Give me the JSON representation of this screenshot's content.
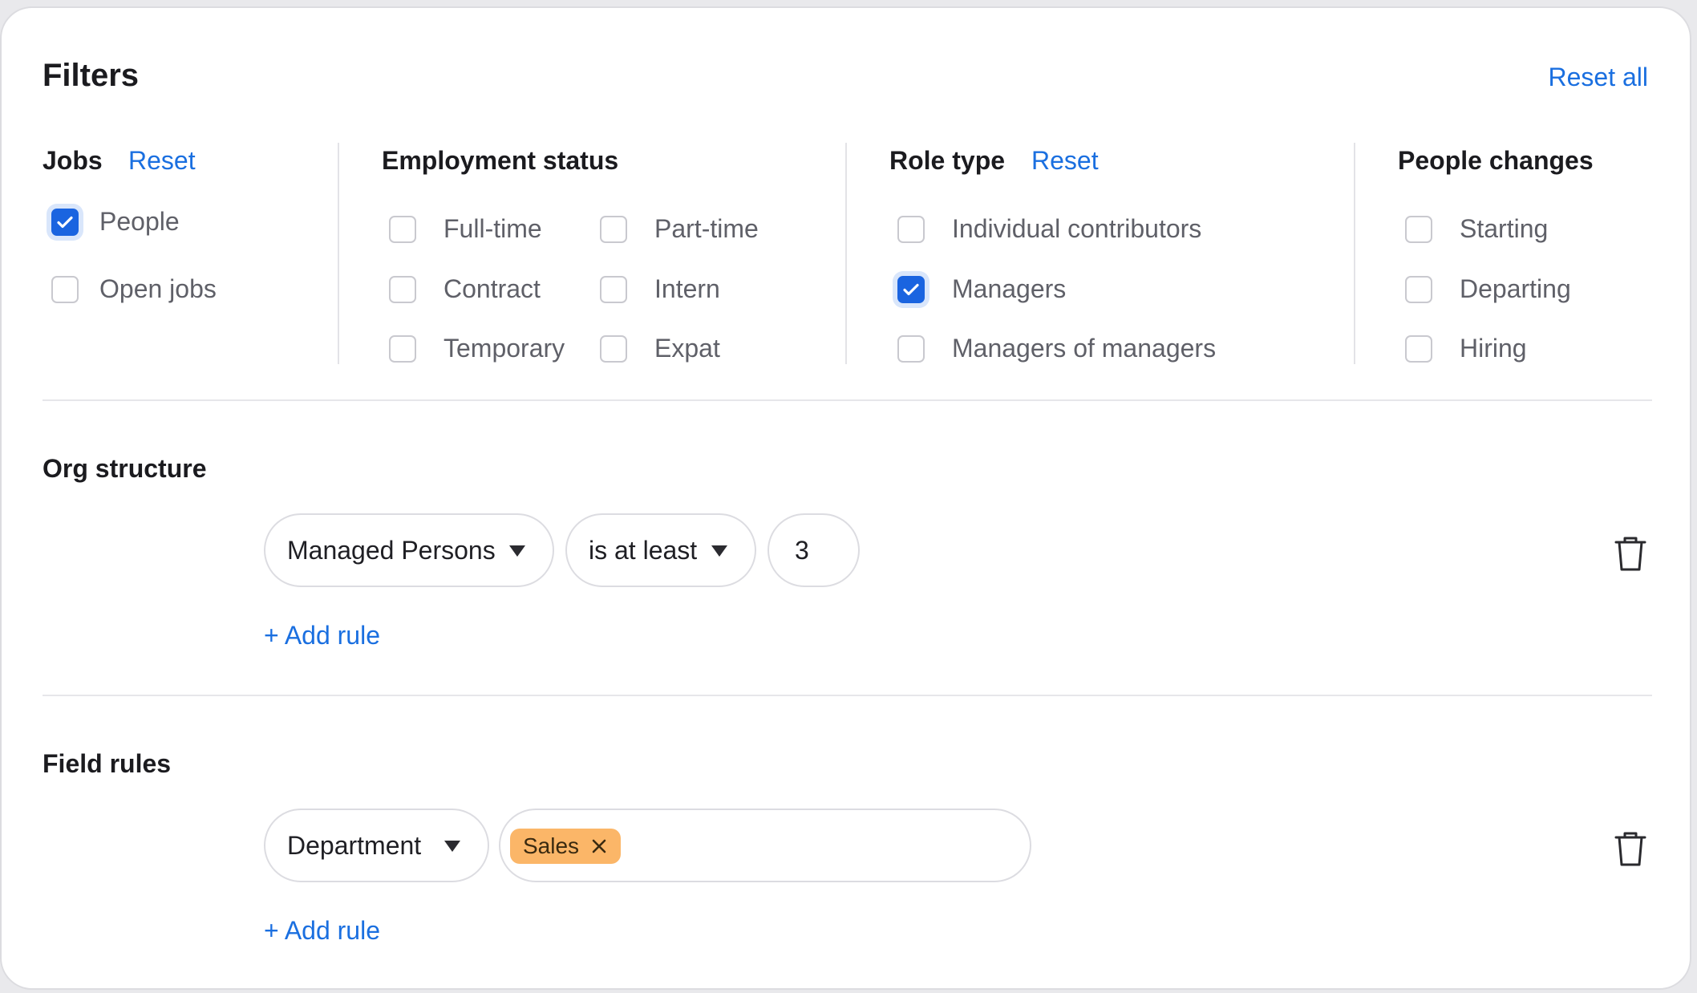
{
  "header": {
    "title": "Filters",
    "reset_all": "Reset all"
  },
  "jobs": {
    "title": "Jobs",
    "reset": "Reset",
    "options": [
      {
        "label": "People",
        "checked": true
      },
      {
        "label": "Open jobs",
        "checked": false
      }
    ]
  },
  "employment_status": {
    "title": "Employment status",
    "options": [
      {
        "label": "Full-time",
        "checked": false
      },
      {
        "label": "Part-time",
        "checked": false
      },
      {
        "label": "Contract",
        "checked": false
      },
      {
        "label": "Intern",
        "checked": false
      },
      {
        "label": "Temporary",
        "checked": false
      },
      {
        "label": "Expat",
        "checked": false
      }
    ]
  },
  "role_type": {
    "title": "Role type",
    "reset": "Reset",
    "options": [
      {
        "label": "Individual contributors",
        "checked": false
      },
      {
        "label": "Managers",
        "checked": true
      },
      {
        "label": "Managers of managers",
        "checked": false
      }
    ]
  },
  "people_changes": {
    "title": "People changes",
    "options": [
      {
        "label": "Starting",
        "checked": false
      },
      {
        "label": "Departing",
        "checked": false
      },
      {
        "label": "Hiring",
        "checked": false
      }
    ]
  },
  "org_structure": {
    "title": "Org structure",
    "rule": {
      "field": "Managed Persons",
      "operator": "is at least",
      "value": "3"
    },
    "add_rule": "+ Add rule"
  },
  "field_rules": {
    "title": "Field rules",
    "rule": {
      "field": "Department",
      "tags": [
        "Sales"
      ]
    },
    "add_rule": "+ Add rule"
  },
  "colors": {
    "accent": "#1a6fe0",
    "checkbox_checked": "#1a64e0",
    "tag_bg": "#fbb668"
  }
}
